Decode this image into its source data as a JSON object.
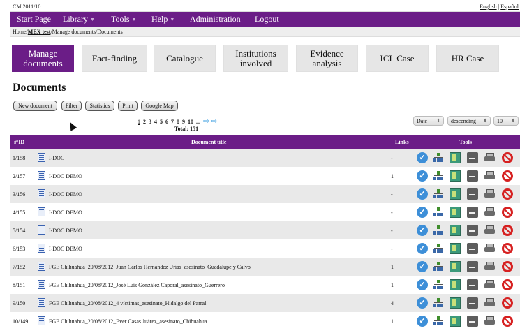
{
  "app": {
    "version": "CM 2011/10"
  },
  "languages": [
    "English",
    "Español"
  ],
  "menu": [
    {
      "label": "Start Page",
      "dropdown": false
    },
    {
      "label": "Library",
      "dropdown": true
    },
    {
      "label": "Tools",
      "dropdown": true
    },
    {
      "label": "Help",
      "dropdown": true
    },
    {
      "label": "Administration",
      "dropdown": false
    },
    {
      "label": "Logout",
      "dropdown": false
    }
  ],
  "breadcrumb": {
    "prefix": "Home/",
    "link": "MEX test",
    "suffix": "/Manage documents/Documents"
  },
  "tabs": [
    {
      "label": "Manage documents",
      "active": true
    },
    {
      "label": "Fact-finding",
      "active": false
    },
    {
      "label": "Catalogue",
      "active": false
    },
    {
      "label": "Institutions involved",
      "active": false
    },
    {
      "label": "Evidence analysis",
      "active": false
    },
    {
      "label": "ICL Case",
      "active": false
    },
    {
      "label": "HR Case",
      "active": false
    }
  ],
  "page": {
    "title": "Documents"
  },
  "actions": [
    "New document",
    "Filter",
    "Statistics",
    "Print",
    "Google Map"
  ],
  "pagination": {
    "pages": [
      "1",
      "2",
      "3",
      "4",
      "5",
      "6",
      "7",
      "8",
      "9",
      "10",
      "..."
    ],
    "current": "1",
    "total": "Total: 151"
  },
  "sorting": {
    "field": "Date",
    "order": "descending",
    "per_page": "10"
  },
  "table": {
    "headers": {
      "id": "#/ID",
      "title": "Document title",
      "links": "Links",
      "tools": "Tools"
    },
    "rows": [
      {
        "id": "1/158",
        "title": "I-DOC",
        "links": "-"
      },
      {
        "id": "2/157",
        "title": "I-DOC DEMO",
        "links": "1"
      },
      {
        "id": "3/156",
        "title": "I-DOC DEMO",
        "links": "-"
      },
      {
        "id": "4/155",
        "title": "I-DOC DEMO",
        "links": "-"
      },
      {
        "id": "5/154",
        "title": "I-DOC DEMO",
        "links": "-"
      },
      {
        "id": "6/153",
        "title": "I-DOC DEMO",
        "links": "-"
      },
      {
        "id": "7/152",
        "title": "FGE Chihuahua_20/08/2012_Juan Carlos Hernández Urías_asesinato_Guadalupe y Calvo",
        "links": "1"
      },
      {
        "id": "8/151",
        "title": "FGE Chihuahua_20/08/2012_José Luis González Caporal_asesinato_Guerrero",
        "links": "1"
      },
      {
        "id": "9/150",
        "title": "FGE Chihuahua_20/08/2012_4 víctimas_asesinato_Hidalgo del Parral",
        "links": "4"
      },
      {
        "id": "10/149",
        "title": "FGE Chihuahua_20/08/2012_Ever Casas Juárez_asesinato_Chihuahua",
        "links": "1"
      }
    ]
  },
  "row_tools": [
    "check-icon",
    "hierarchy-icon",
    "map-icon",
    "download-icon",
    "print-icon",
    "delete-icon"
  ],
  "colors": {
    "brand_purple": "#6b1d87",
    "row_shade": "#e9e9e9",
    "delete_red": "#d62020",
    "check_blue": "#3d8fd8"
  }
}
